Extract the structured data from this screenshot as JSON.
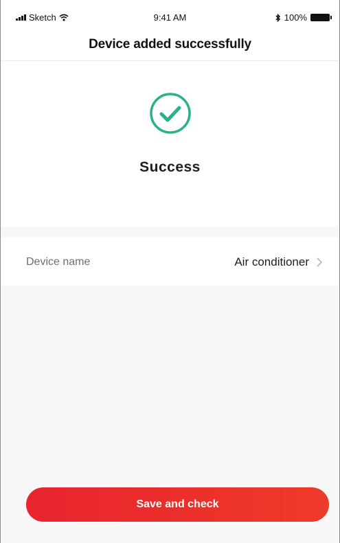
{
  "status_bar": {
    "carrier": "Sketch",
    "time": "9:41 AM",
    "battery": "100%"
  },
  "nav": {
    "title": "Device added successfully"
  },
  "success": {
    "icon": "check-circle-icon",
    "icon_color": "#2bb08a",
    "label": "Success"
  },
  "device": {
    "label": "Device name",
    "value": "Air conditioner"
  },
  "actions": {
    "save_label": "Save and check",
    "button_color": "#e8242d"
  }
}
